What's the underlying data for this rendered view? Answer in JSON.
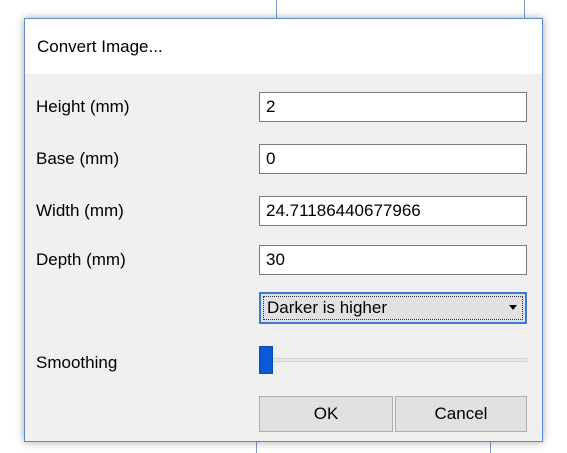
{
  "dialog": {
    "title": "Convert Image..."
  },
  "fields": [
    {
      "label": "Height (mm)",
      "value": "2"
    },
    {
      "label": "Base (mm)",
      "value": "0"
    },
    {
      "label": "Width (mm)",
      "value": "24.71186440677966"
    },
    {
      "label": "Depth (mm)",
      "value": "30"
    }
  ],
  "mode_select": {
    "selected": "Darker is higher",
    "icon": "chevron-down-icon"
  },
  "smoothing": {
    "label": "Smoothing",
    "level": 0
  },
  "buttons": {
    "ok": "OK",
    "cancel": "Cancel"
  },
  "colors": {
    "accent": "#0a5ad6",
    "dialog_border": "#5b8bc9",
    "dialog_bg": "#f0f0f0"
  }
}
